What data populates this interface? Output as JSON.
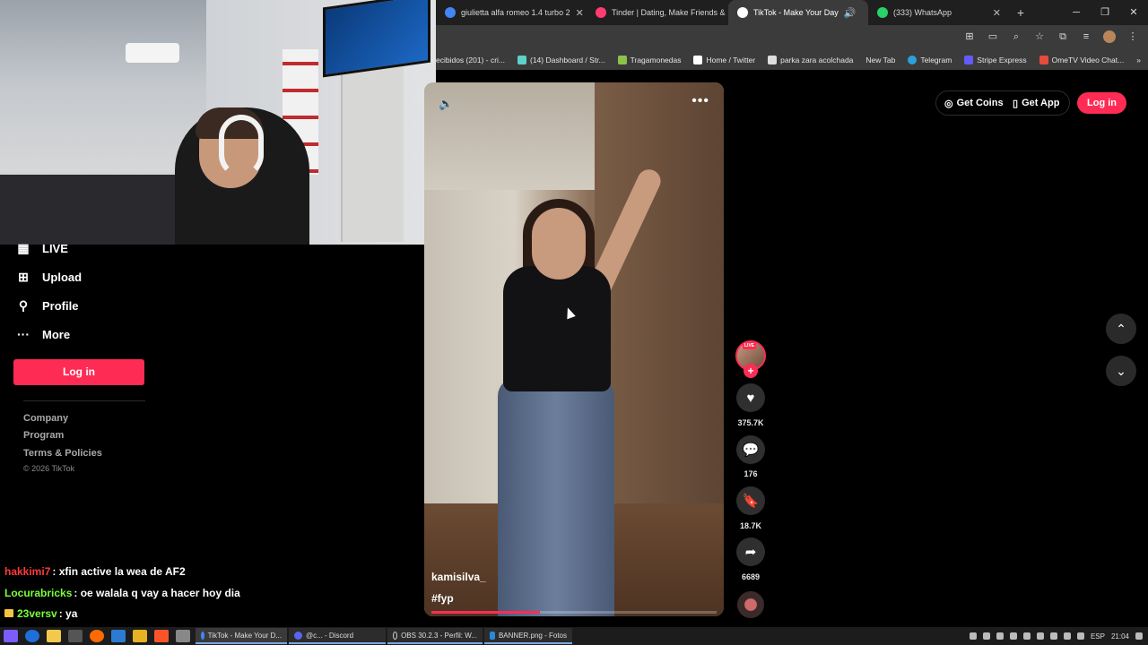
{
  "browser": {
    "tabs": [
      {
        "label": "giulietta alfa romeo 1.4 turbo 2",
        "color": "#4285f4",
        "active": false
      },
      {
        "label": "Tinder | Dating, Make Friends &",
        "color": "#fe3c72",
        "active": false
      },
      {
        "label": "TikTok - Make Your Day",
        "color": "#ffffff",
        "active": true
      },
      {
        "label": "(333) WhatsApp",
        "color": "#25d366",
        "active": false
      }
    ],
    "bookmarks": [
      {
        "label": "ecibidos (201) - cri...",
        "color": "#888888"
      },
      {
        "label": "(14) Dashboard / Str...",
        "color": "#5fd1c9"
      },
      {
        "label": "Tragamonedas",
        "color": "#8bc34a"
      },
      {
        "label": "Home / Twitter",
        "color": "#ffffff"
      },
      {
        "label": "parka zara acolchada",
        "color": "#dddddd"
      },
      {
        "label": "New Tab",
        "color": "#3b3b3b"
      },
      {
        "label": "Telegram",
        "color": "#2aa1da"
      },
      {
        "label": "Stripe Express",
        "color": "#635bff"
      },
      {
        "label": "OmeTV Video Chat...",
        "color": "#e84a3b"
      }
    ]
  },
  "sidebar": {
    "items": [
      {
        "label": "LIVE",
        "icon": "live-icon"
      },
      {
        "label": "Upload",
        "icon": "upload-icon"
      },
      {
        "label": "Profile",
        "icon": "profile-icon"
      },
      {
        "label": "More",
        "icon": "more-icon"
      }
    ],
    "login_label": "Log in",
    "footer": [
      "Company",
      "Program",
      "Terms & Policies"
    ],
    "copyright": "© 2026 TikTok"
  },
  "chat": [
    {
      "user": "hakkimi7",
      "message": ": xfin active la wea de AF2",
      "color": "#ff3b3b"
    },
    {
      "user": "Locurabricks",
      "message": ": oe walala q vay a hacer hoy dia",
      "color": "#7cff3b"
    },
    {
      "user": "23versv",
      "message": ": ya",
      "color": "#7cff3b"
    }
  ],
  "video": {
    "author": "kamisilva_",
    "hashtag": "#fyp",
    "progress": 0.38,
    "live_badge": "LIVE",
    "follow_symbol": "+",
    "likes": "375.7K",
    "comments": "176",
    "saves": "18.7K",
    "shares": "6689"
  },
  "header": {
    "get_coins": "Get Coins",
    "get_app": "Get App",
    "login": "Log in"
  },
  "taskbar": {
    "apps": [
      {
        "label": "TikTok - Make Your D...",
        "active": true
      },
      {
        "label": "@c... - Discord",
        "active": false
      },
      {
        "label": "OBS 30.2.3 - Perfil: W...",
        "active": false
      },
      {
        "label": "BANNER.png - Fotos",
        "active": false
      }
    ],
    "lang": "ESP",
    "time": "21:04"
  },
  "colors": {
    "accent": "#fe2c55"
  }
}
